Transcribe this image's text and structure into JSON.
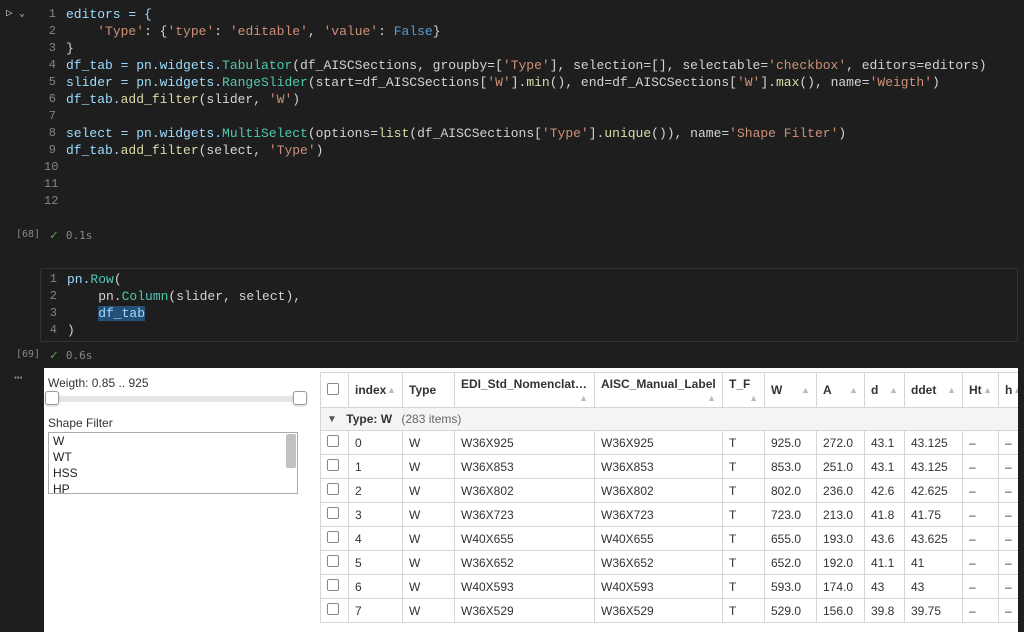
{
  "cells": {
    "c1": {
      "counter": "[68]",
      "status_time": "0.1s"
    },
    "c2": {
      "counter": "[69]",
      "status_time": "0.6s"
    }
  },
  "code1": {
    "l1": "editors = {",
    "l2_key": "'Type'",
    "l2_mid": ": {",
    "l2_k2": "'type'",
    "l2_c2": ": ",
    "l2_v2": "'editable'",
    "l2_c3": ", ",
    "l2_k3": "'value'",
    "l2_c4": ": ",
    "l2_v3": "False",
    "l2_end": "}",
    "l3": "}",
    "l4_a": "df_tab = pn.widgets.",
    "l4_b": "Tabulator",
    "l4_c": "(df_AISCSections, groupby=[",
    "l4_d": "'Type'",
    "l4_e": "], selection=[], selectable=",
    "l4_f": "'checkbox'",
    "l4_g": ", editors=editors)",
    "l5_a": "slider = pn.widgets.",
    "l5_b": "RangeSlider",
    "l5_c": "(start=df_AISCSections[",
    "l5_d": "'W'",
    "l5_e": "].",
    "l5_f": "min",
    "l5_g": "(), end=df_AISCSections[",
    "l5_h": "'W'",
    "l5_i": "].",
    "l5_j": "max",
    "l5_k": "(), name=",
    "l5_l": "'Weigth'",
    "l5_m": ")",
    "l6_a": "df_tab.",
    "l6_b": "add_filter",
    "l6_c": "(slider, ",
    "l6_d": "'W'",
    "l6_e": ")",
    "l8_a": "select = pn.widgets.",
    "l8_b": "MultiSelect",
    "l8_c": "(options=",
    "l8_d": "list",
    "l8_e": "(df_AISCSections[",
    "l8_f": "'Type'",
    "l8_g": "].",
    "l8_h": "unique",
    "l8_i": "()), name=",
    "l8_j": "'Shape Filter'",
    "l8_k": ")",
    "l9_a": "df_tab.",
    "l9_b": "add_filter",
    "l9_c": "(select, ",
    "l9_d": "'Type'",
    "l9_e": ")"
  },
  "code2": {
    "l1_a": "pn.",
    "l1_b": "Row",
    "l1_c": "(",
    "l2_a": "    pn.",
    "l2_b": "Column",
    "l2_c": "(slider, select),",
    "l3_a": "    ",
    "l3_b": "df_tab",
    "l4": ")"
  },
  "widgets": {
    "slider_label": "Weigth: 0.85 .. 925",
    "ms_label": "Shape Filter",
    "ms_options": [
      "W",
      "WT",
      "HSS",
      "HP"
    ]
  },
  "table": {
    "headers": [
      "index",
      "Type",
      "EDI_Std_Nomenclature",
      "AISC_Manual_Label",
      "T_F",
      "W",
      "A",
      "d",
      "ddet",
      "Ht",
      "h"
    ],
    "group_label": "Type: W",
    "group_count": "(283 items)",
    "rows": [
      {
        "index": "0",
        "Type": "W",
        "EDI": "W36X925",
        "AISC": "W36X925",
        "TF": "T",
        "W": "925.0",
        "A": "272.0",
        "d": "43.1",
        "ddet": "43.125",
        "Ht": "–",
        "h": "–"
      },
      {
        "index": "1",
        "Type": "W",
        "EDI": "W36X853",
        "AISC": "W36X853",
        "TF": "T",
        "W": "853.0",
        "A": "251.0",
        "d": "43.1",
        "ddet": "43.125",
        "Ht": "–",
        "h": "–"
      },
      {
        "index": "2",
        "Type": "W",
        "EDI": "W36X802",
        "AISC": "W36X802",
        "TF": "T",
        "W": "802.0",
        "A": "236.0",
        "d": "42.6",
        "ddet": "42.625",
        "Ht": "–",
        "h": "–"
      },
      {
        "index": "3",
        "Type": "W",
        "EDI": "W36X723",
        "AISC": "W36X723",
        "TF": "T",
        "W": "723.0",
        "A": "213.0",
        "d": "41.8",
        "ddet": "41.75",
        "Ht": "–",
        "h": "–"
      },
      {
        "index": "4",
        "Type": "W",
        "EDI": "W40X655",
        "AISC": "W40X655",
        "TF": "T",
        "W": "655.0",
        "A": "193.0",
        "d": "43.6",
        "ddet": "43.625",
        "Ht": "–",
        "h": "–"
      },
      {
        "index": "5",
        "Type": "W",
        "EDI": "W36X652",
        "AISC": "W36X652",
        "TF": "T",
        "W": "652.0",
        "A": "192.0",
        "d": "41.1",
        "ddet": "41",
        "Ht": "–",
        "h": "–"
      },
      {
        "index": "6",
        "Type": "W",
        "EDI": "W40X593",
        "AISC": "W40X593",
        "TF": "T",
        "W": "593.0",
        "A": "174.0",
        "d": "43",
        "ddet": "43",
        "Ht": "–",
        "h": "–"
      },
      {
        "index": "7",
        "Type": "W",
        "EDI": "W36X529",
        "AISC": "W36X529",
        "TF": "T",
        "W": "529.0",
        "A": "156.0",
        "d": "39.8",
        "ddet": "39.75",
        "Ht": "–",
        "h": "–"
      }
    ]
  }
}
